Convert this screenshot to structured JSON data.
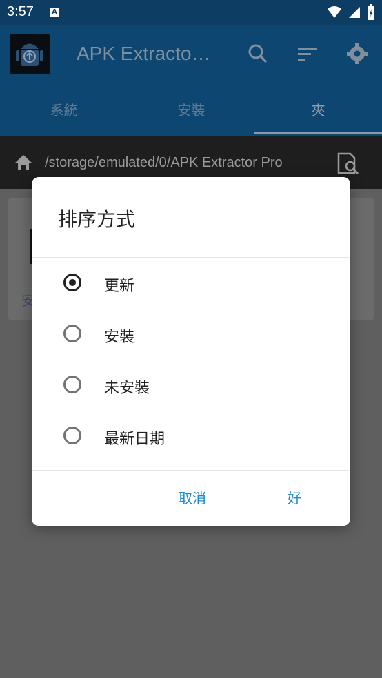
{
  "status_bar": {
    "time": "3:57",
    "notification_badge": "A"
  },
  "app_bar": {
    "title": "APK Extracto…"
  },
  "tabs": [
    {
      "label": "系統"
    },
    {
      "label": "安裝"
    },
    {
      "label": "夾"
    }
  ],
  "path_bar": {
    "path": "/storage/emulated/0/APK Extractor Pro"
  },
  "background_card": {
    "text": "安"
  },
  "dialog": {
    "title": "排序方式",
    "options": [
      {
        "label": "更新",
        "selected": true
      },
      {
        "label": "安裝",
        "selected": false
      },
      {
        "label": "未安裝",
        "selected": false
      },
      {
        "label": "最新日期",
        "selected": false
      }
    ],
    "cancel_label": "取消",
    "ok_label": "好"
  },
  "colors": {
    "accent": "#1e8ac9",
    "scrim": "#5f5f5f",
    "app_bar": "#0e4672"
  }
}
